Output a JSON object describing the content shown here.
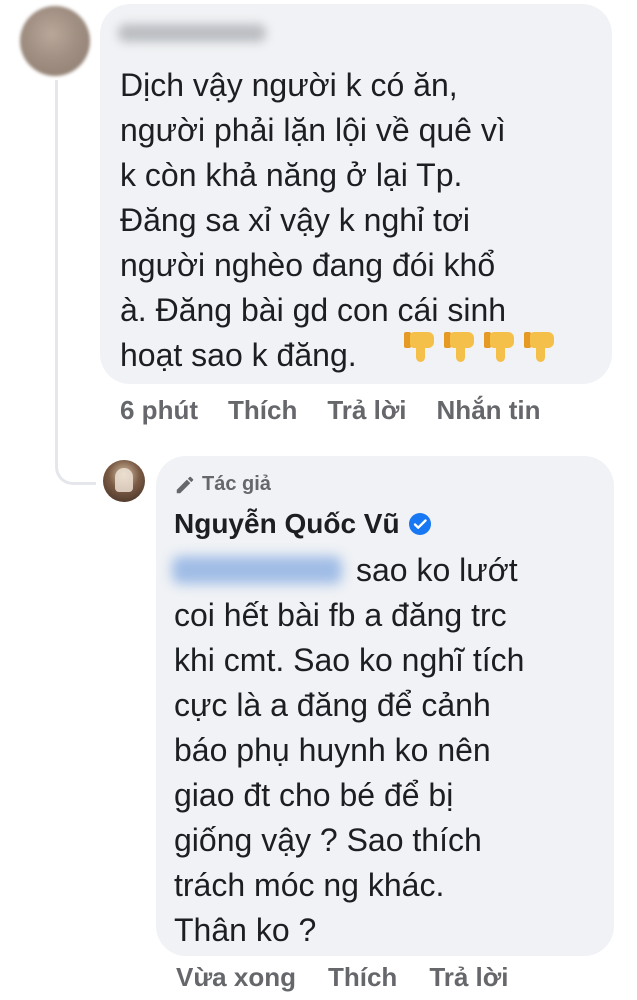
{
  "comment": {
    "text": "Dịch vậy người k có ăn,\nngười phải lặn lội về quê vì\nk còn khả năng ở lại Tp.\nĐăng sa xỉ vậy k nghỉ tơi\nngười nghèo đang đói khổ\nà. Đăng bài gd con cái sinh\nhoạt sao k đăng.",
    "emoji": "thumbs-down-icon",
    "emoji_count": 4,
    "time": "6 phút",
    "like_label": "Thích",
    "reply_label": "Trả lời",
    "message_label": "Nhắn tin"
  },
  "reply": {
    "badge_label": "Tác giả",
    "author_name": "Nguyễn Quốc Vũ",
    "verified_icon": "verified-badge-icon",
    "text": "sao ko lướt\ncoi hết bài fb a đăng trc\nkhi cmt. Sao ko nghĩ tích\ncực là a đăng để cảnh\nbáo phụ huynh ko nên\ngiao đt cho bé để bị\ngiống vậy ? Sao thích\ntrách móc ng khác.\nThân ko ?",
    "time": "Vừa xong",
    "like_label": "Thích",
    "reply_label": "Trả lời"
  },
  "colors": {
    "bubble": "#f0f2f5",
    "secondary_text": "#65676b",
    "verified": "#1877f2",
    "emoji": "#f5c04a"
  }
}
